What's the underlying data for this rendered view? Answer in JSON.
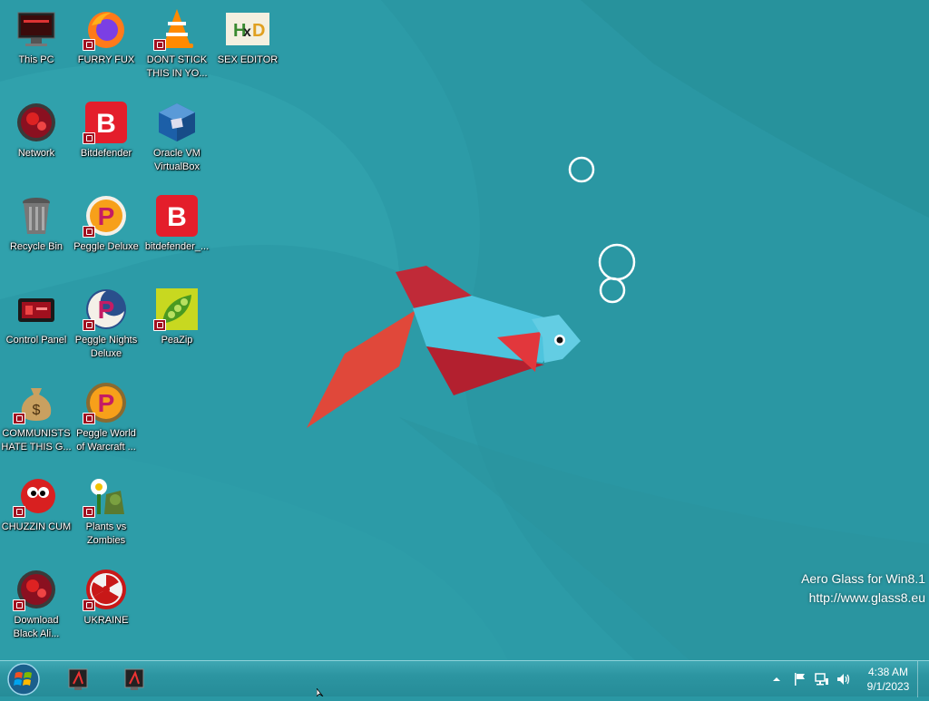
{
  "desktop": {
    "icons": [
      {
        "label": "This PC",
        "icon": "this-pc-icon"
      },
      {
        "label": "Network",
        "icon": "network-icon"
      },
      {
        "label": "Recycle Bin",
        "icon": "recycle-bin-icon"
      },
      {
        "label": "Control Panel",
        "icon": "control-panel-icon"
      },
      {
        "label": "COMMUNISTS HATE THIS G...",
        "icon": "money-bag-icon"
      },
      {
        "label": "CHUZZIN CUM",
        "icon": "chuzzle-icon"
      },
      {
        "label": "Download Black Ali...",
        "icon": "download-icon"
      },
      {
        "label": "FURRY FUX",
        "icon": "firefox-icon"
      },
      {
        "label": "Bitdefender",
        "icon": "bitdefender-icon"
      },
      {
        "label": "Peggle Deluxe",
        "icon": "peggle-icon"
      },
      {
        "label": "Peggle Nights Deluxe",
        "icon": "peggle-nights-icon"
      },
      {
        "label": "Peggle World of Warcraft ...",
        "icon": "peggle-wow-icon"
      },
      {
        "label": "Plants vs Zombies",
        "icon": "plants-vs-zombies-icon"
      },
      {
        "label": "UKRAINE",
        "icon": "radiation-icon"
      },
      {
        "label": "DONT STICK THIS IN YO...",
        "icon": "vlc-icon"
      },
      {
        "label": "Oracle VM VirtualBox",
        "icon": "virtualbox-icon"
      },
      {
        "label": "bitdefender_...",
        "icon": "bitdefender-icon"
      },
      {
        "label": "PeaZip",
        "icon": "peazip-icon"
      },
      {
        "label": "SEX EDITOR",
        "icon": "hxd-icon"
      }
    ]
  },
  "watermark": {
    "line1": "Aero Glass for Win8.1",
    "line2": "http://www.glass8.eu"
  },
  "taskbar": {
    "start_icon": "windows-orb-icon",
    "pinned": [
      {
        "icon": "pinned-app-icon"
      },
      {
        "icon": "pinned-app-icon"
      }
    ],
    "clock": {
      "time": "4:38 AM",
      "date": "9/1/2023"
    },
    "tray_icons": [
      "show-hidden-icons",
      "flag-icon",
      "network-icon",
      "volume-icon"
    ]
  },
  "colors": {
    "wallpaper": "#2a97a3",
    "taskbar": "#2c95a1",
    "fish_body": "#4fc3dc",
    "fish_fin": "#c8283a",
    "fish_tail": "#e04a3a"
  }
}
